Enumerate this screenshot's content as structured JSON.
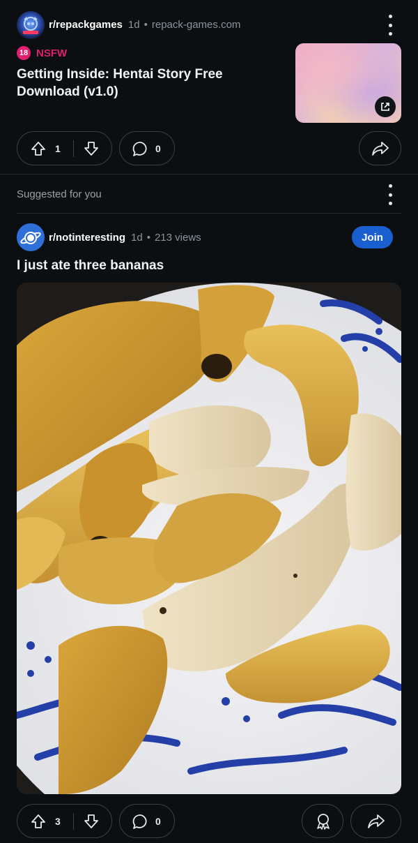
{
  "post1": {
    "subreddit": "r/repackgames",
    "time": "1d",
    "separator": "•",
    "domain": "repack-games.com",
    "nsfw_badge": "18",
    "nsfw_label": "NSFW",
    "title": "Getting Inside: Hentai Story Free Download (v1.0)",
    "upvotes": "1",
    "comments": "0"
  },
  "suggested": {
    "label": "Suggested for you"
  },
  "post2": {
    "subreddit": "r/notinteresting",
    "time": "1d",
    "separator": "•",
    "views": "213 views",
    "join_label": "Join",
    "title": "I just ate three bananas",
    "upvotes": "3",
    "comments": "0"
  },
  "colors": {
    "background": "#0b0f12",
    "nsfw": "#e0206e",
    "join": "#1a5fd0",
    "border": "#3a4046"
  }
}
